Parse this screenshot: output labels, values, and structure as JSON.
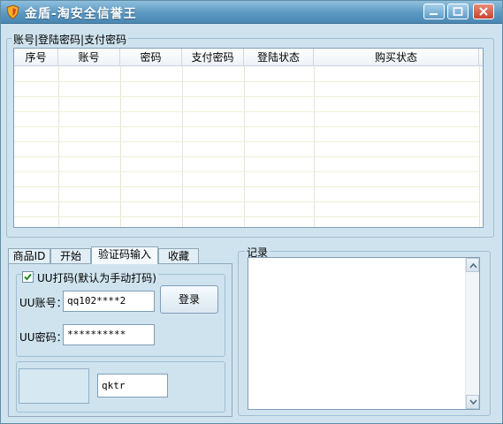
{
  "window": {
    "title": "金盾-淘安全信誉王",
    "accent_color": "#5b98c2",
    "controls": [
      "minimize-icon",
      "maximize-icon",
      "close-icon"
    ]
  },
  "accounts_group": {
    "label": "账号|登陆密码|支付密码",
    "columns": [
      "序号",
      "账号",
      "密码",
      "支付密码",
      "登陆状态",
      "购买状态"
    ],
    "rows": []
  },
  "tabs": {
    "items": [
      "商品ID",
      "开始",
      "验证码输入",
      "收藏"
    ],
    "active": "验证码输入"
  },
  "uu_panel": {
    "checkbox_label": "UU打码(默认为手动打码)",
    "checkbox_checked": true,
    "account_label": "UU账号：",
    "account_value": "qq102****2",
    "password_label": "UU密码：",
    "password_value": "**********",
    "login_button": "登录"
  },
  "captcha": {
    "input_value": "qktr"
  },
  "record": {
    "label": "记录"
  }
}
